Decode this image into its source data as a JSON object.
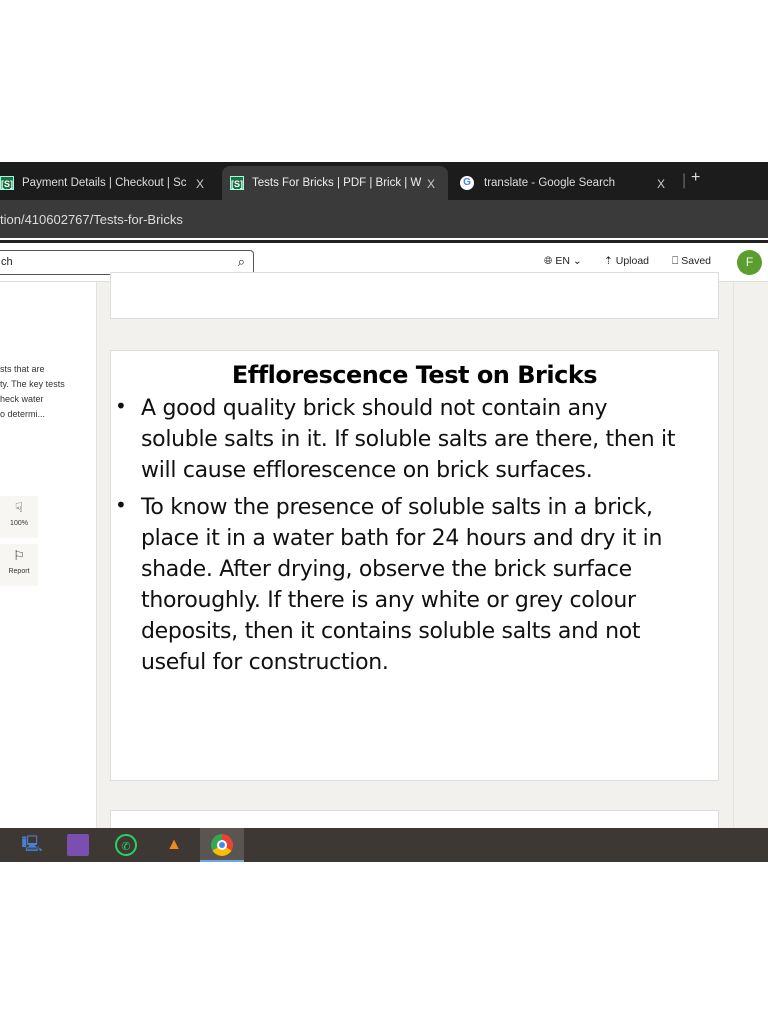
{
  "tabs": [
    {
      "label": "Payment Details | Checkout | Sc",
      "favicon": "[S]"
    },
    {
      "label": "Tests For Bricks | PDF | Brick | W",
      "favicon": "[S]"
    },
    {
      "label": "translate - Google Search",
      "favicon": "G"
    }
  ],
  "tab_close": "X",
  "new_tab": "+",
  "address": "tion/410602767/Tests-for-Bricks",
  "header": {
    "search_placeholder": "ch",
    "lang": "EN ⌄",
    "upload": "Upload",
    "saved": "Saved",
    "avatar": "F"
  },
  "sidebar": {
    "desc": [
      "sts that are",
      "ty. The key tests",
      "heck water",
      "o determi..."
    ],
    "dislike_pct": "100%",
    "report": "Report"
  },
  "document": {
    "title": "Efflorescence Test on Bricks",
    "bullets": [
      "A good quality brick should not contain any soluble salts in it. If soluble salts are there, then it will cause efflorescence on brick surfaces.",
      "To know the presence of soluble salts in a brick, place it in a water bath for 24 hours and dry it in shade. After drying, observe the brick surface thoroughly. If there is any white or grey colour deposits, then it contains soluble salts and not useful for construction."
    ]
  }
}
